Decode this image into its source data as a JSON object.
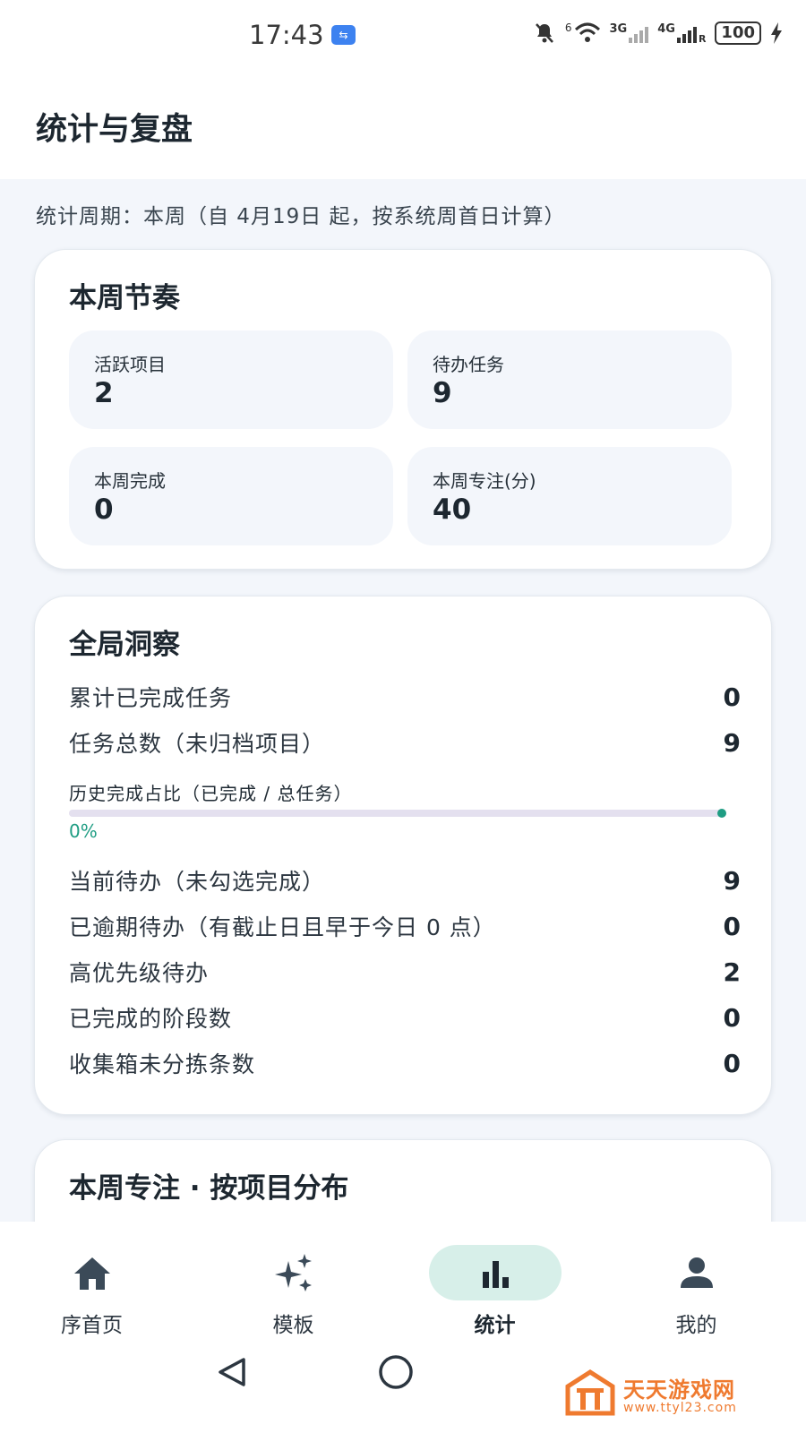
{
  "status_bar": {
    "time": "17:43",
    "network_labels": [
      "6",
      "3G",
      "4G",
      "R"
    ],
    "battery": "100"
  },
  "header": {
    "title": "统计与复盘"
  },
  "period": {
    "text": "统计周期：本周（自 4月19日 起，按系统周首日计算）"
  },
  "weekly_rhythm": {
    "title": "本周节奏",
    "tiles": [
      {
        "label": "活跃项目",
        "value": "2"
      },
      {
        "label": "待办任务",
        "value": "9"
      },
      {
        "label": "本周完成",
        "value": "0"
      },
      {
        "label": "本周专注(分)",
        "value": "40"
      }
    ]
  },
  "global_insight": {
    "title": "全局洞察",
    "rows_top": [
      {
        "label": "累计已完成任务",
        "value": "0"
      },
      {
        "label": "任务总数（未归档项目）",
        "value": "9"
      }
    ],
    "progress": {
      "label": "历史完成占比（已完成 / 总任务）",
      "percent_text": "0%",
      "percent": 0
    },
    "rows_bottom": [
      {
        "label": "当前待办（未勾选完成）",
        "value": "9"
      },
      {
        "label": "已逾期待办（有截止日且早于今日 0 点）",
        "value": "0"
      },
      {
        "label": "高优先级待办",
        "value": "2"
      },
      {
        "label": "已完成的阶段数",
        "value": "0"
      },
      {
        "label": "收集箱未分拣条数",
        "value": "0"
      }
    ]
  },
  "focus_distribution": {
    "title": "本周专注 · 按项目分布"
  },
  "bottom_nav": {
    "items": [
      {
        "label": "序首页",
        "icon": "home-icon"
      },
      {
        "label": "模板",
        "icon": "sparkles-icon"
      },
      {
        "label": "统计",
        "icon": "bar-chart-icon",
        "active": true
      },
      {
        "label": "我的",
        "icon": "person-icon"
      }
    ]
  },
  "system_nav": {
    "buttons": [
      "back",
      "home"
    ]
  },
  "watermark": {
    "name": "天天游戏网",
    "url": "www.ttyl23.com"
  },
  "colors": {
    "accent": "#1f9d83",
    "active_pill": "#d7efe9",
    "background": "#f3f6fb"
  }
}
